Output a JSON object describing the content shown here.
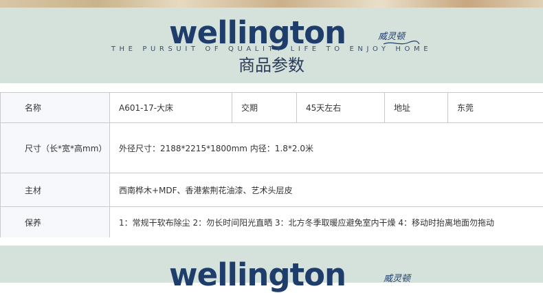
{
  "brand": {
    "wordmark": "wellington",
    "chinese_name": "威灵顿",
    "tagline": "THE PURSUIT OF QUALITY LIFE TO ENJOY HOME",
    "color": "#1f3d6a"
  },
  "section_title": "商品参数",
  "params": {
    "name_label": "名称",
    "name_value": "A601-17-大床",
    "delivery_label": "交期",
    "delivery_value": "45天左右",
    "address_label": "地址",
    "address_value": "东莞",
    "size_label": "尺寸（长*宽*高mm）",
    "size_value": "外径尺寸：2188*2215*1800mm  内径：1.8*2.0米",
    "material_label": "主材",
    "material_value": "西南桦木+MDF、香港紫荆花油漆、艺术头层皮",
    "care_label": "保养",
    "care_value": "1：常规干软布除尘 2：勿长时间阳光直晒 3：北方冬季取暖应避免室内干燥 4：移动时抬离地面勿拖动"
  },
  "colors": {
    "banner_bg": "#d5e1db",
    "label_cell_bg": "#f6f8fb",
    "border": "#c9c9c9"
  }
}
